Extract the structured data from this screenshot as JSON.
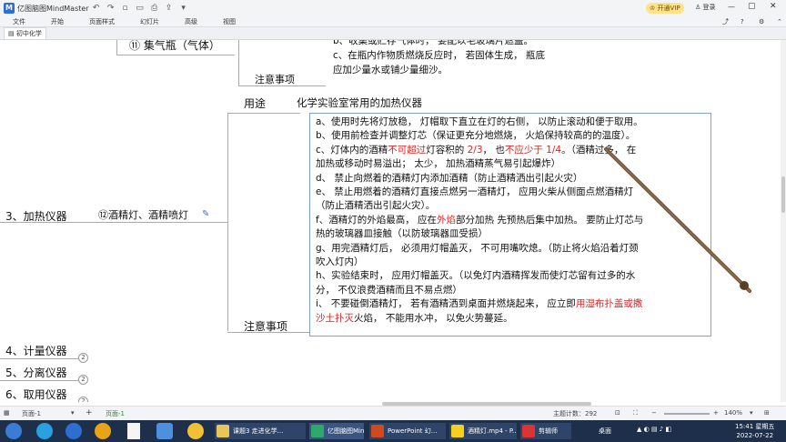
{
  "app": {
    "title": "亿图脑图MindMaster",
    "vip_label": "开通VIP",
    "login_label": "登录"
  },
  "menu": [
    "文件",
    "开始",
    "页面样式",
    "幻灯片",
    "高级",
    "视图"
  ],
  "doc_tab": "初中化学",
  "mindmap": {
    "top_node": "⑪ 集气瓶（气体）",
    "top_notes": [
      "b、收集或贮存气体时， 要配以毛玻璃片遮盖。",
      "c、在瓶内作物质燃烧反应时， 若固体生成， 瓶底",
      "应加少量水或铺少量细沙。"
    ],
    "top_notes_label": "注意事项",
    "branch_heating": "3、加热仪器",
    "node_lamp": "⑫酒精灯、酒精喷灯",
    "usage_label": "用途",
    "usage_text": "化学实验室常用的加热仪器",
    "notes_label": "注意事项",
    "notes_lines": [
      {
        "segments": [
          {
            "t": "a、使用时先将灯放稳， 灯帽取下直立在灯的右侧， 以防止滚动和便于取用。",
            "c": ""
          }
        ]
      },
      {
        "segments": [
          {
            "t": "b、使用前检查并调整灯芯（保证更充分地燃烧， 火焰保持较高的的温度）。",
            "c": ""
          }
        ]
      },
      {
        "segments": [
          {
            "t": "c、灯体内的酒精",
            "c": ""
          },
          {
            "t": "不可超过",
            "c": "red"
          },
          {
            "t": "灯容积的 ",
            "c": ""
          },
          {
            "t": "2/3",
            "c": "red"
          },
          {
            "t": "， 也",
            "c": ""
          },
          {
            "t": "不应少于 1/4",
            "c": "red"
          },
          {
            "t": "。（酒精过多， 在",
            "c": ""
          }
        ]
      },
      {
        "segments": [
          {
            "t": "加热或移动时易溢出； 太少， 加热酒精蒸气易引起爆炸）",
            "c": ""
          }
        ]
      },
      {
        "segments": [
          {
            "t": "d、 禁止向燃着的酒精灯内添加酒精（防止酒精洒出引起火灾）",
            "c": ""
          }
        ]
      },
      {
        "segments": [
          {
            "t": "e、 禁止用燃着的酒精灯直接点燃另一酒精灯， 应用火柴从侧面点燃酒精灯",
            "c": ""
          }
        ]
      },
      {
        "segments": [
          {
            "t": "（防止酒精洒出引起火灾）。",
            "c": ""
          }
        ]
      },
      {
        "segments": [
          {
            "t": "f、酒精灯的外焰最高， 应在",
            "c": ""
          },
          {
            "t": "外焰",
            "c": "red"
          },
          {
            "t": "部分加热 先预热后集中加热。 要防止灯芯与",
            "c": ""
          }
        ]
      },
      {
        "segments": [
          {
            "t": "热的玻璃器皿接触（以防玻璃器皿受损）",
            "c": ""
          }
        ]
      },
      {
        "segments": [
          {
            "t": "g、用完酒精灯后， 必须用灯帽盖灭， 不可用嘴吹熄。（防止将火焰沿着灯颈",
            "c": ""
          }
        ]
      },
      {
        "segments": [
          {
            "t": "吹入灯内）",
            "c": ""
          }
        ]
      },
      {
        "segments": [
          {
            "t": "h、实验结束时， 应用灯帽盖灭。（以免灯内酒精挥发而使灯芯留有过多的水",
            "c": ""
          }
        ]
      },
      {
        "segments": [
          {
            "t": "分， 不仅浪费酒精而且不易点燃）",
            "c": ""
          }
        ]
      },
      {
        "segments": [
          {
            "t": "i、 不要碰倒酒精灯， 若有酒精洒到桌面并燃烧起来， 应立即",
            "c": ""
          },
          {
            "t": "用湿布扑盖或撒",
            "c": "red"
          }
        ]
      },
      {
        "segments": [
          {
            "t": "沙土扑灭",
            "c": "red"
          },
          {
            "t": "火焰， 不能用水冲， 以免火势蔓延。",
            "c": ""
          }
        ]
      }
    ],
    "branches": [
      {
        "label": "4、计量仪器",
        "count": "2"
      },
      {
        "label": "5、分离仪器",
        "count": "2"
      },
      {
        "label": "6、取用仪器",
        "count": "2"
      }
    ]
  },
  "status": {
    "page_left": "页面-1",
    "page_tab": "页面-1",
    "topic_count": "主题计数：292",
    "zoom": "140%"
  },
  "taskbar": {
    "items": [
      "课题3 走进化学...",
      "亿图脑图MindM...",
      "PowerPoint 幻...",
      "酒精灯.mp4 - P...",
      "剪辑师"
    ],
    "time": "15:41 星期五",
    "date": "2022-07-22",
    "desktop": "桌面"
  }
}
